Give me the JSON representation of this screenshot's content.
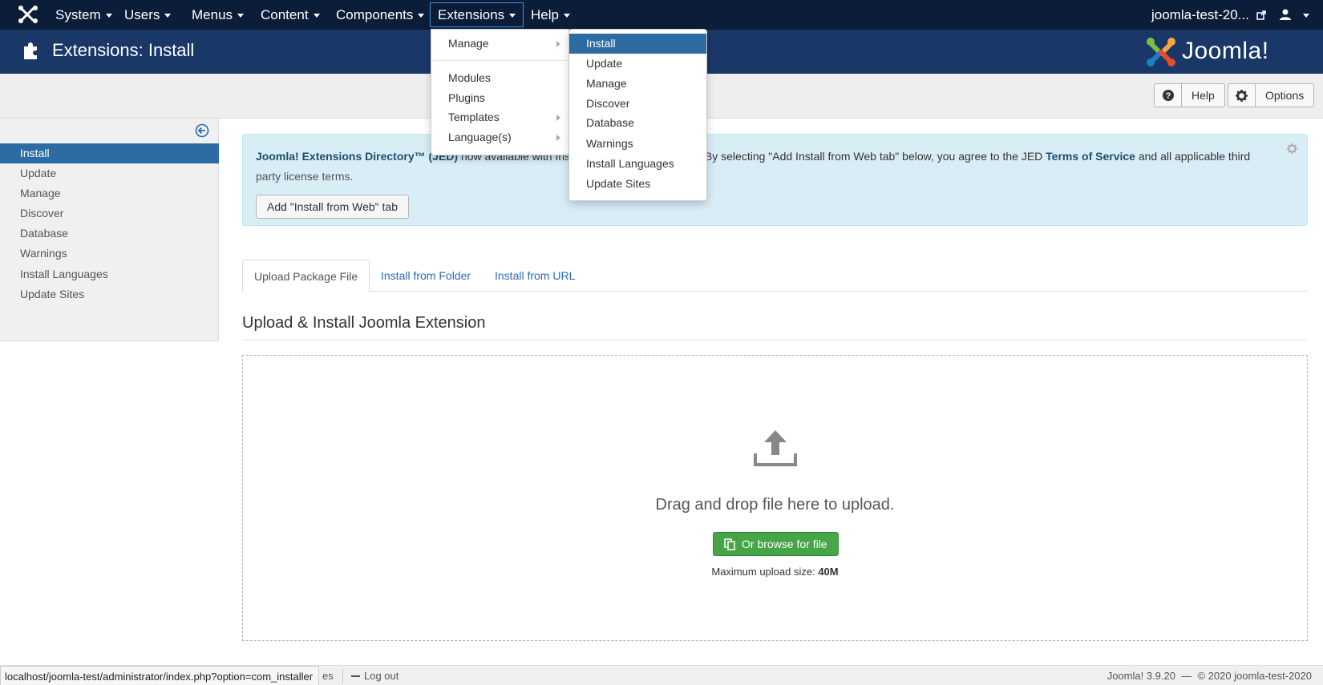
{
  "navbar": {
    "items": [
      "System",
      "Users",
      "Menus",
      "Content",
      "Components",
      "Extensions",
      "Help"
    ],
    "site_name": "joomla-test-20..."
  },
  "header": {
    "title": "Extensions: Install",
    "brand": "Joomla!"
  },
  "toolbar": {
    "help_label": "Help",
    "options_label": "Options"
  },
  "sidebar": {
    "items": [
      "Install",
      "Update",
      "Manage",
      "Discover",
      "Database",
      "Warnings",
      "Install Languages",
      "Update Sites"
    ],
    "active": "Install"
  },
  "extensions_menu": {
    "items": [
      "Manage",
      "Modules",
      "Plugins",
      "Templates",
      "Language(s)"
    ]
  },
  "manage_submenu": {
    "items": [
      "Install",
      "Update",
      "Manage",
      "Discover",
      "Database",
      "Warnings",
      "Install Languages",
      "Update Sites"
    ],
    "active": "Install"
  },
  "alert": {
    "jed_label": "Joomla! Extensions Directory™ (JED)",
    "obscured_text": "now available with Ins",
    "line1": ". By selecting \"Add Install from Web tab\" below, you agree to the JED ",
    "tos_label": "Terms of Service",
    "line1_end": " and all applicable third",
    "line2": "party license terms.",
    "button_label": "Add \"Install from Web\" tab"
  },
  "tabs": [
    "Upload Package File",
    "Install from Folder",
    "Install from URL"
  ],
  "active_tab": "Upload Package File",
  "upload": {
    "title": "Upload & Install Joomla Extension",
    "drop_text": "Drag and drop file here to upload.",
    "browse_label": "Or browse for file",
    "max_label": "Maximum upload size: ",
    "max_value": "40M"
  },
  "footer": {
    "status_url": "localhost/joomla-test/administrator/index.php?option=com_installer",
    "fragment": "es",
    "logout_label": "Log out",
    "version": "Joomla! 3.9.20",
    "copyright": "© 2020 joomla-test-2020"
  },
  "colors": {
    "navbar_bg": "#0c1d3a",
    "header_bg": "#1a3867",
    "active_blue": "#2d6ca2",
    "link_blue": "#2a69b8",
    "success_green": "#46a546",
    "alert_bg": "#d9edf7"
  }
}
